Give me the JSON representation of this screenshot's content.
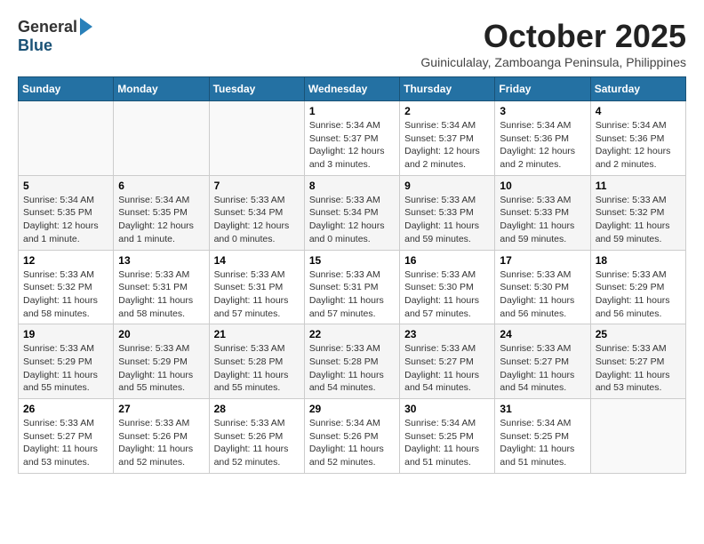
{
  "header": {
    "logo_general": "General",
    "logo_blue": "Blue",
    "month_title": "October 2025",
    "subtitle": "Guiniculalay, Zamboanga Peninsula, Philippines"
  },
  "weekdays": [
    "Sunday",
    "Monday",
    "Tuesday",
    "Wednesday",
    "Thursday",
    "Friday",
    "Saturday"
  ],
  "weeks": [
    [
      {
        "day": "",
        "info": ""
      },
      {
        "day": "",
        "info": ""
      },
      {
        "day": "",
        "info": ""
      },
      {
        "day": "1",
        "info": "Sunrise: 5:34 AM\nSunset: 5:37 PM\nDaylight: 12 hours and 3 minutes."
      },
      {
        "day": "2",
        "info": "Sunrise: 5:34 AM\nSunset: 5:37 PM\nDaylight: 12 hours and 2 minutes."
      },
      {
        "day": "3",
        "info": "Sunrise: 5:34 AM\nSunset: 5:36 PM\nDaylight: 12 hours and 2 minutes."
      },
      {
        "day": "4",
        "info": "Sunrise: 5:34 AM\nSunset: 5:36 PM\nDaylight: 12 hours and 2 minutes."
      }
    ],
    [
      {
        "day": "5",
        "info": "Sunrise: 5:34 AM\nSunset: 5:35 PM\nDaylight: 12 hours and 1 minute."
      },
      {
        "day": "6",
        "info": "Sunrise: 5:34 AM\nSunset: 5:35 PM\nDaylight: 12 hours and 1 minute."
      },
      {
        "day": "7",
        "info": "Sunrise: 5:33 AM\nSunset: 5:34 PM\nDaylight: 12 hours and 0 minutes."
      },
      {
        "day": "8",
        "info": "Sunrise: 5:33 AM\nSunset: 5:34 PM\nDaylight: 12 hours and 0 minutes."
      },
      {
        "day": "9",
        "info": "Sunrise: 5:33 AM\nSunset: 5:33 PM\nDaylight: 11 hours and 59 minutes."
      },
      {
        "day": "10",
        "info": "Sunrise: 5:33 AM\nSunset: 5:33 PM\nDaylight: 11 hours and 59 minutes."
      },
      {
        "day": "11",
        "info": "Sunrise: 5:33 AM\nSunset: 5:32 PM\nDaylight: 11 hours and 59 minutes."
      }
    ],
    [
      {
        "day": "12",
        "info": "Sunrise: 5:33 AM\nSunset: 5:32 PM\nDaylight: 11 hours and 58 minutes."
      },
      {
        "day": "13",
        "info": "Sunrise: 5:33 AM\nSunset: 5:31 PM\nDaylight: 11 hours and 58 minutes."
      },
      {
        "day": "14",
        "info": "Sunrise: 5:33 AM\nSunset: 5:31 PM\nDaylight: 11 hours and 57 minutes."
      },
      {
        "day": "15",
        "info": "Sunrise: 5:33 AM\nSunset: 5:31 PM\nDaylight: 11 hours and 57 minutes."
      },
      {
        "day": "16",
        "info": "Sunrise: 5:33 AM\nSunset: 5:30 PM\nDaylight: 11 hours and 57 minutes."
      },
      {
        "day": "17",
        "info": "Sunrise: 5:33 AM\nSunset: 5:30 PM\nDaylight: 11 hours and 56 minutes."
      },
      {
        "day": "18",
        "info": "Sunrise: 5:33 AM\nSunset: 5:29 PM\nDaylight: 11 hours and 56 minutes."
      }
    ],
    [
      {
        "day": "19",
        "info": "Sunrise: 5:33 AM\nSunset: 5:29 PM\nDaylight: 11 hours and 55 minutes."
      },
      {
        "day": "20",
        "info": "Sunrise: 5:33 AM\nSunset: 5:29 PM\nDaylight: 11 hours and 55 minutes."
      },
      {
        "day": "21",
        "info": "Sunrise: 5:33 AM\nSunset: 5:28 PM\nDaylight: 11 hours and 55 minutes."
      },
      {
        "day": "22",
        "info": "Sunrise: 5:33 AM\nSunset: 5:28 PM\nDaylight: 11 hours and 54 minutes."
      },
      {
        "day": "23",
        "info": "Sunrise: 5:33 AM\nSunset: 5:27 PM\nDaylight: 11 hours and 54 minutes."
      },
      {
        "day": "24",
        "info": "Sunrise: 5:33 AM\nSunset: 5:27 PM\nDaylight: 11 hours and 54 minutes."
      },
      {
        "day": "25",
        "info": "Sunrise: 5:33 AM\nSunset: 5:27 PM\nDaylight: 11 hours and 53 minutes."
      }
    ],
    [
      {
        "day": "26",
        "info": "Sunrise: 5:33 AM\nSunset: 5:27 PM\nDaylight: 11 hours and 53 minutes."
      },
      {
        "day": "27",
        "info": "Sunrise: 5:33 AM\nSunset: 5:26 PM\nDaylight: 11 hours and 52 minutes."
      },
      {
        "day": "28",
        "info": "Sunrise: 5:33 AM\nSunset: 5:26 PM\nDaylight: 11 hours and 52 minutes."
      },
      {
        "day": "29",
        "info": "Sunrise: 5:34 AM\nSunset: 5:26 PM\nDaylight: 11 hours and 52 minutes."
      },
      {
        "day": "30",
        "info": "Sunrise: 5:34 AM\nSunset: 5:25 PM\nDaylight: 11 hours and 51 minutes."
      },
      {
        "day": "31",
        "info": "Sunrise: 5:34 AM\nSunset: 5:25 PM\nDaylight: 11 hours and 51 minutes."
      },
      {
        "day": "",
        "info": ""
      }
    ]
  ]
}
